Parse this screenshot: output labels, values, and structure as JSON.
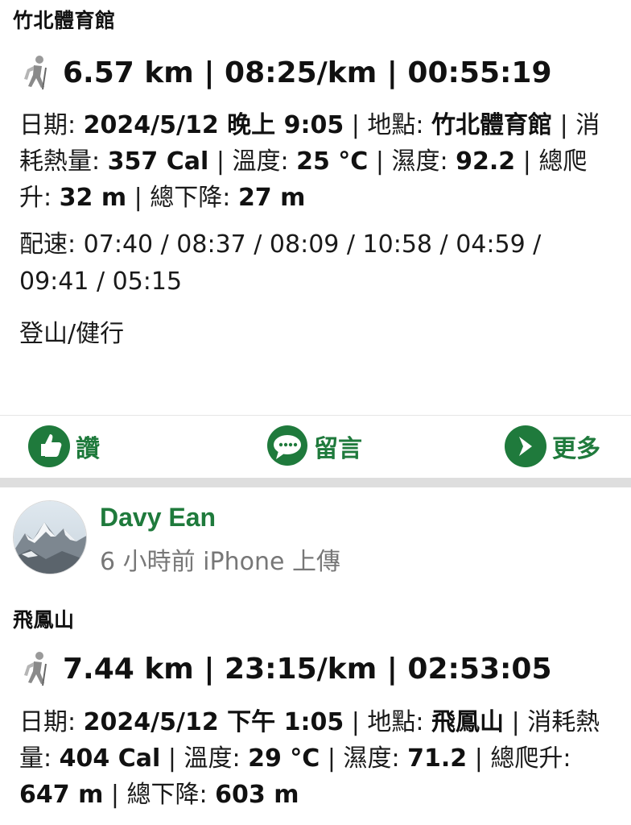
{
  "post1": {
    "title": "竹北體育館",
    "stats": "6.57 km | 08:25/km | 00:55:19",
    "date_label": "日期: ",
    "date_value": "2024/5/12 晚上 9:05",
    "location_label": " | 地點: ",
    "location_value": "竹北體育館",
    "calories_label": " | 消耗熱量: ",
    "calories_value": "357 Cal",
    "temp_label": " | 溫度: ",
    "temp_value": "25 °C",
    "humidity_label": " | 濕度: ",
    "humidity_value": "92.2",
    "ascent_label": " | 總爬升: ",
    "ascent_value": "32 m",
    "descent_label": " | 總下降: ",
    "descent_value": "27 m",
    "pace_label": "配速: ",
    "pace_values": "07:40 / 08:37 / 08:09 / 10:58 / 04:59 / 09:41 / 05:15",
    "activity": "登山/健行"
  },
  "actions": {
    "like_label": "讚",
    "comment_label": "留言",
    "more_label": "更多"
  },
  "post2": {
    "user_name": "Davy Ean",
    "meta": "6 小時前 iPhone 上傳",
    "title": "飛鳳山",
    "stats": "7.44 km | 23:15/km | 02:53:05",
    "date_label": "日期: ",
    "date_value": "2024/5/12 下午 1:05",
    "location_label": " | 地點: ",
    "location_value": "飛鳳山",
    "calories_label": " | 消耗熱量: ",
    "calories_value": "404 Cal",
    "temp_label": " | 溫度: ",
    "temp_value": "29 °C",
    "humidity_label": " | 濕度: ",
    "humidity_value": "71.2",
    "ascent_label": " | 總爬升: ",
    "ascent_value": "647 m",
    "descent_label": " | 總下降: ",
    "descent_value": "603 m"
  },
  "colors": {
    "accent_green": "#1f7a3c",
    "meta_gray": "#777777"
  },
  "icons": [
    "hiker-icon",
    "thumbs-up-icon",
    "comment-bubble-icon",
    "arrow-right-icon"
  ]
}
